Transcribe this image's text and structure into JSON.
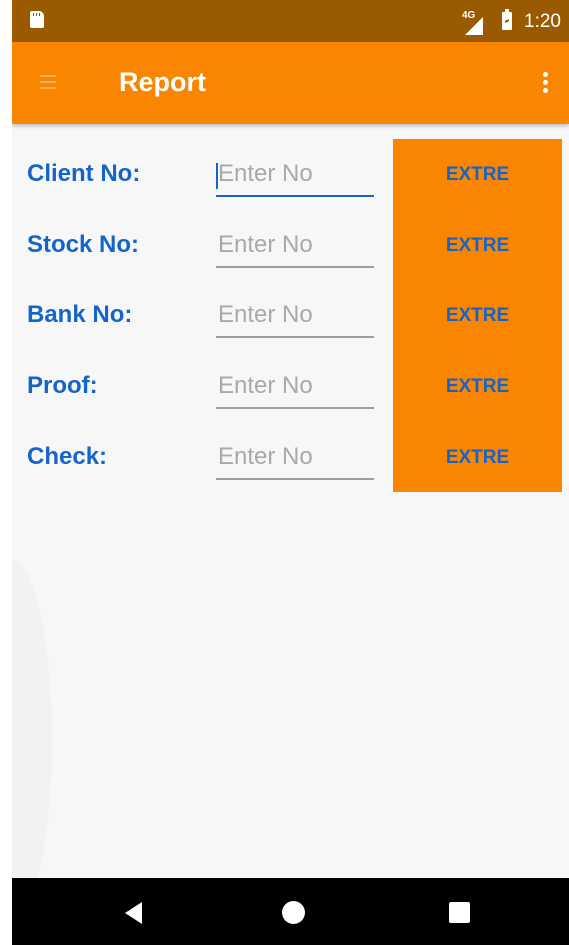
{
  "status_bar": {
    "time": "1:20",
    "network": "4G",
    "icons": [
      "sd-card-icon",
      "signal-icon",
      "battery-charging-icon"
    ]
  },
  "app_bar": {
    "title": "Report",
    "background": "#f98500",
    "icons": [
      "menu-icon",
      "overflow-menu-icon"
    ]
  },
  "form": {
    "label_color": "#1565c8",
    "rows": [
      {
        "label": "Client No:",
        "placeholder": "Enter No",
        "value": "",
        "focused": true
      },
      {
        "label": "Stock No:",
        "placeholder": "Enter No",
        "value": ""
      },
      {
        "label": "Bank No:",
        "placeholder": "Enter No",
        "value": ""
      },
      {
        "label": "Proof:",
        "placeholder": "Enter No",
        "value": ""
      },
      {
        "label": "Check:",
        "placeholder": "Enter No",
        "value": ""
      }
    ],
    "buttons": [
      {
        "label": "EXTRE"
      },
      {
        "label": "EXTRE"
      },
      {
        "label": "EXTRE"
      },
      {
        "label": "EXTRE"
      },
      {
        "label": "EXTRE"
      }
    ]
  },
  "nav_bar": {
    "icons": [
      "back-icon",
      "home-icon",
      "recents-icon"
    ]
  }
}
